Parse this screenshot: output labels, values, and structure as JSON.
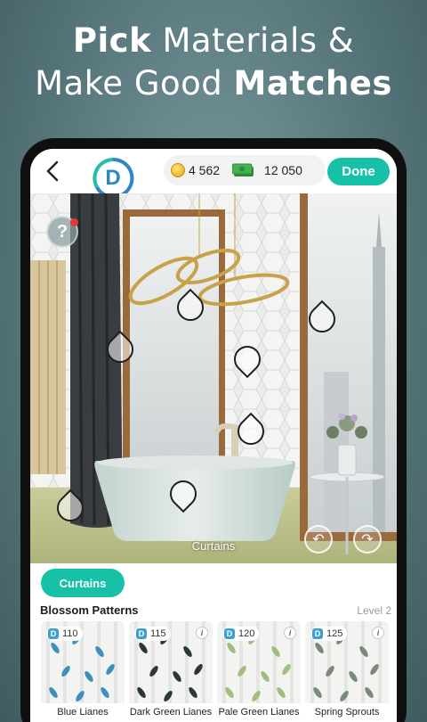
{
  "headline": {
    "line1_bold": "Pick",
    "line1_rest": " Materials &",
    "line2_rest": "Make Good ",
    "line2_bold": "Matches"
  },
  "header": {
    "logo_letter": "D",
    "coins": "4 562",
    "cash": "12 050",
    "done_label": "Done"
  },
  "scene": {
    "help_label": "?",
    "selected_object_label": "Curtains"
  },
  "tabs": [
    {
      "label": "Curtains",
      "active": true
    }
  ],
  "collection": {
    "title": "Blossom Patterns",
    "level": "Level 2",
    "items": [
      {
        "badge_letter": "D",
        "price": "110",
        "name": "Blue Lianes",
        "leaf_color": "#3f8fbd"
      },
      {
        "badge_letter": "D",
        "price": "115",
        "name": "Dark Green Lianes",
        "leaf_color": "#2a3a32"
      },
      {
        "badge_letter": "D",
        "price": "120",
        "name": "Pale Green Lianes",
        "leaf_color": "#9fbf7d"
      },
      {
        "badge_letter": "D",
        "price": "125",
        "name": "Spring Sprouts",
        "leaf_color": "#7a8a7a"
      }
    ]
  },
  "colors": {
    "accent": "#17c1a8",
    "badge_blue": "#3da0d2"
  }
}
